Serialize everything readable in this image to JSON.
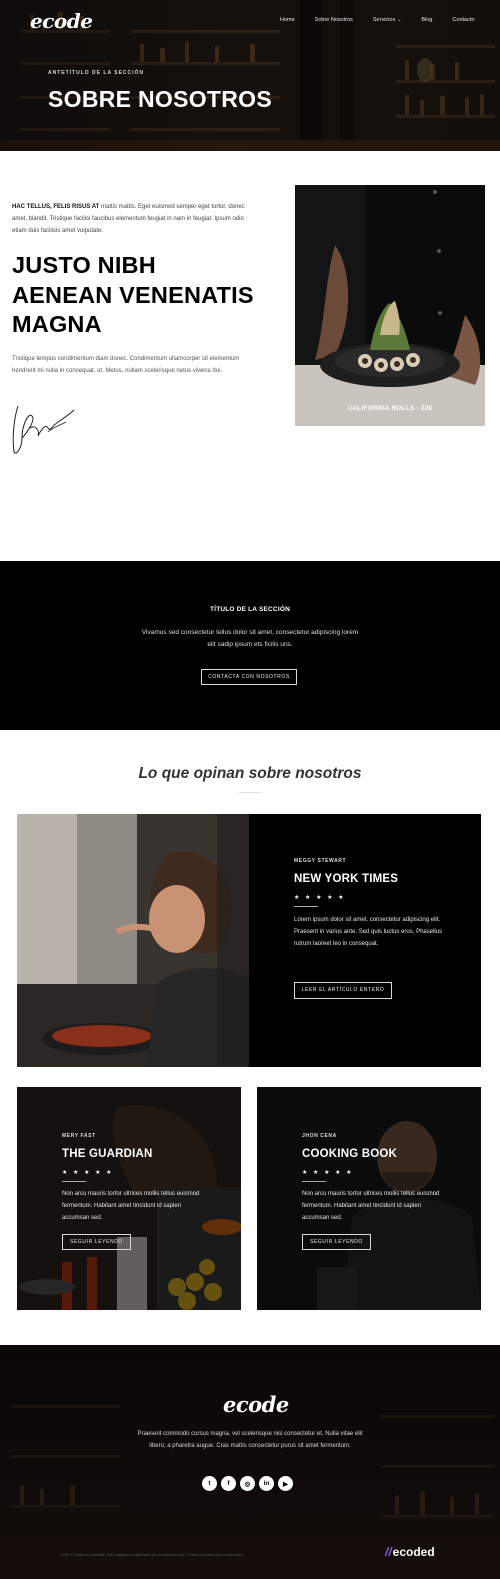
{
  "colors": {
    "dark": "#000000",
    "white": "#ffffff",
    "brand_accent": "#8a5cf6"
  },
  "header": {
    "logo": "ecode",
    "nav": [
      {
        "label": "Home"
      },
      {
        "label": "Sobre Nosotros"
      },
      {
        "label": "Servicios",
        "icon": "chevron-down-icon"
      },
      {
        "label": "Blog"
      },
      {
        "label": "Contacto"
      }
    ],
    "eyebrow": "ANTETÍTULO DE LA SECCIÓN",
    "title": "SOBRE NOSOTROS"
  },
  "about": {
    "intro_bold": "HAC TELLUS, FELIS RISUS AT",
    "intro_text": " mattis mattis. Eget euismod semper eget tortor, donec amet, blandit. Tristique facilisi faucibus elementum feugiat in nam in feugiat. Ipsum odio etiam duis facilisis amet vulputate.",
    "title": "JUSTO NIBH AENEAN VENENATIS MAGNA",
    "description": "Tristique tempus condimentum diam donec. Condimentum ullamcorper sit elementum hendrerit mi nulla in consequat, ut. Metus, nullam scelerisque netus viverra dui.",
    "image_caption": "CALIFORNIA ROLLS - 22€"
  },
  "cta": {
    "title": "TÍTULO DE LA SECCIÓN",
    "text": "Vivamus sed consectetur tellus dolor sit amet, consectetur adipiscing lorem elit sadip ipsum ets ficilis uns.",
    "button": "CONTACTA CON NOSOTROS"
  },
  "testimonials": {
    "heading": "Lo que opinan sobre nosotros",
    "featured": {
      "author": "MEGGY STEWART",
      "publication": "NEW YORK TIMES",
      "stars": "★ ★ ★ ★ ★",
      "text": "Lorem ipsum dolor sit amet, consectetur adipiscing elit. Praesent in varius ante. Sed quis luctus eros. Phasellus rutrum laoreet leo in consequat.",
      "button": "LEER EL ARTÍCULO ENTERO"
    },
    "cards": [
      {
        "author": "MERY FAST",
        "publication": "THE GUARDIAN",
        "stars": "★ ★ ★ ★ ★",
        "text": "Non arcu mauris tortor ultrices mollis tellus euismod fermentum. Habitant amet tincidunt id sapien accumsan sed.",
        "button": "SEGUIR LEYENDO"
      },
      {
        "author": "JHON CENA",
        "publication": "COOKING BOOK",
        "stars": "★ ★ ★ ★ ★",
        "text": "Non arcu mauris tortor ultrices mollis tellus euismod fermentum. Habitant amet tincidunt id sapien accumsan sed.",
        "button": "SEGUIR LEYENDO"
      }
    ]
  },
  "footer": {
    "logo": "ecode",
    "text": "Praesent commodo cursus magna, vel scelerisque nisl consectetur et. Nulla vitae elit libero, a pharetra augue. Cras mattis consectetur purus sit amet fermentum.",
    "socials": [
      "twitter-icon",
      "facebook-icon",
      "instagram-icon",
      "linkedin-icon",
      "youtube-icon"
    ],
    "social_glyphs": [
      "t",
      "f",
      "◎",
      "in",
      "▶"
    ],
    "copyright": "2021 © Proyecto plantilla. Esta página es diseñada por ecodeweb.com. Todos los derechos reservados.",
    "brand_bars": "//",
    "brand": "ecoded"
  }
}
